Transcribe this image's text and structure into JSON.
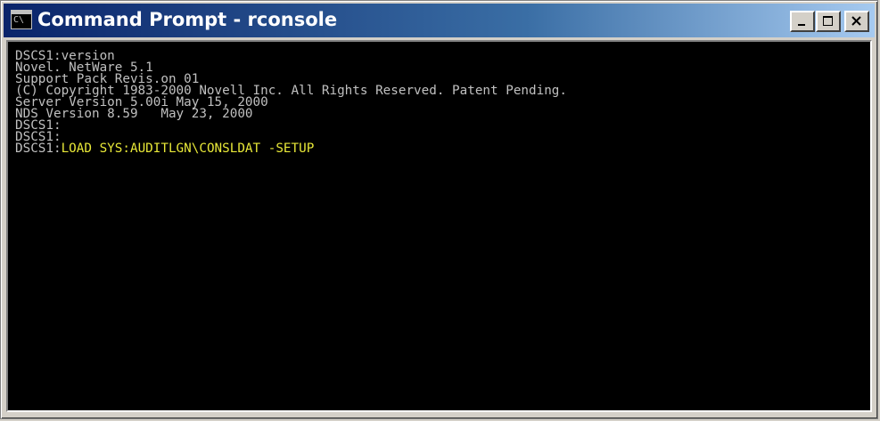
{
  "window": {
    "title": "Command Prompt - rconsole",
    "icon": "console-icon",
    "icon_glyph": "C\\",
    "controls": {
      "minimize": "minimize-icon",
      "maximize": "maximize-icon",
      "close": "close-icon"
    }
  },
  "console": {
    "lines": [
      "DSCS1:version",
      "Novel. NetWare 5.1",
      "Support Pack Revis.on 01",
      "(C) Copyright 1983-2000 Novell Inc. All Rights Reserved. Patent Pending.",
      "Server Version 5.00i May 15, 2000",
      "NDS Version 8.59   May 23, 2000",
      "DSCS1:",
      "DSCS1:"
    ],
    "prompt": "DSCS1:",
    "current_command": "LOAD SYS:AUDITLGN\\CONSLDAT -SETUP"
  },
  "colors": {
    "console_background": "#000000",
    "console_text": "#c0c0c0",
    "command_text": "#e8e838",
    "titlebar_start": "#0a246a",
    "titlebar_end": "#a6caf0"
  }
}
